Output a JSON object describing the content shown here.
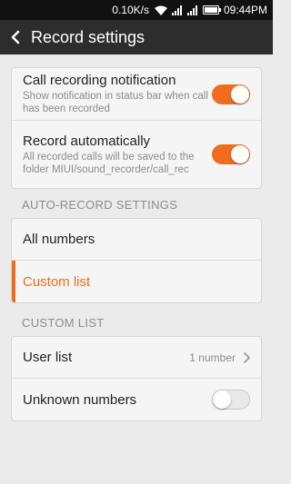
{
  "status_bar": {
    "network_speed": "0.10K/s",
    "time": "09:44PM"
  },
  "header": {
    "title": "Record settings"
  },
  "settings": [
    {
      "label": "Call recording notification",
      "description": "Show notification in status bar when call has been recorded",
      "toggle": "on"
    },
    {
      "label": "Record automatically",
      "description": "All recorded calls will be saved to the folder MIUI/sound_recorder/call_rec",
      "toggle": "on"
    }
  ],
  "auto_record": {
    "header": "AUTO-RECORD SETTINGS",
    "options": [
      {
        "label": "All numbers",
        "selected": false
      },
      {
        "label": "Custom list",
        "selected": true
      }
    ]
  },
  "custom_list": {
    "header": "CUSTOM LIST",
    "user_list": {
      "label": "User list",
      "value": "1 number"
    },
    "unknown_numbers": {
      "label": "Unknown numbers",
      "toggle": "off"
    }
  },
  "colors": {
    "accent": "#f06c1f",
    "titlebar": "#2d2d2d",
    "background": "#ebebeb"
  }
}
